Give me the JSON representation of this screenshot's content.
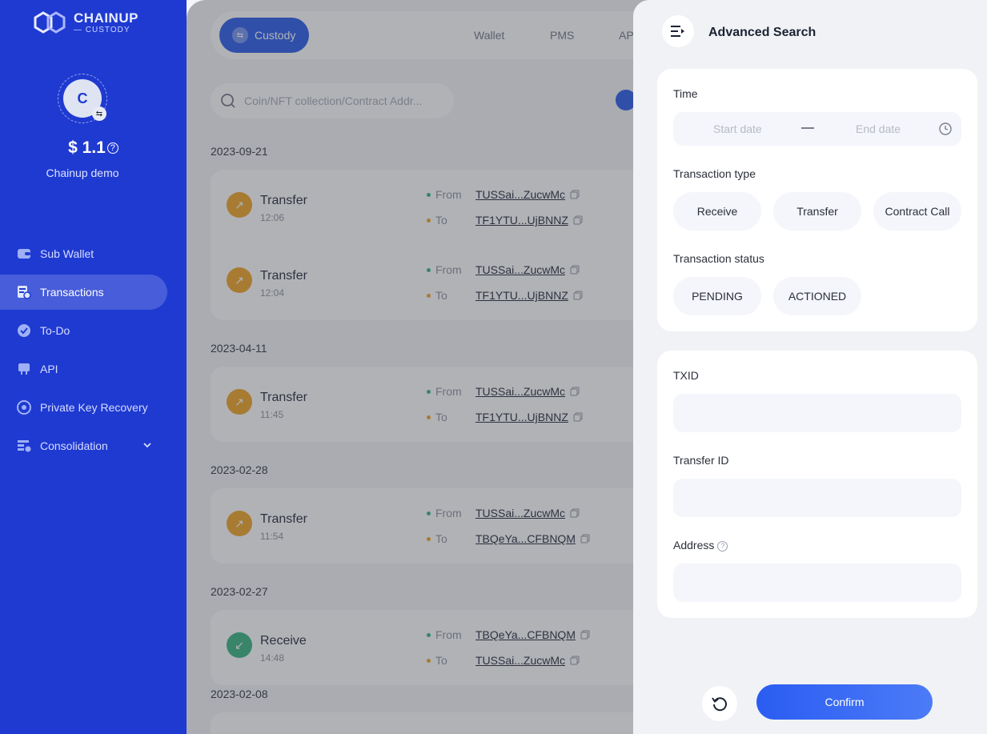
{
  "brand": {
    "name": "CHAINUP",
    "sub": "— CUSTODY"
  },
  "account": {
    "avatar_letter": "C",
    "balance": "$ 1.1",
    "name": "Chainup demo"
  },
  "sidebar": {
    "items": [
      {
        "label": "Sub Wallet",
        "icon": "wallet-icon"
      },
      {
        "label": "Transactions",
        "icon": "transactions-icon",
        "active": true
      },
      {
        "label": "To-Do",
        "icon": "check-circle-icon"
      },
      {
        "label": "API",
        "icon": "api-icon"
      },
      {
        "label": "Private Key Recovery",
        "icon": "key-recovery-icon"
      },
      {
        "label": "Consolidation",
        "icon": "consolidation-icon"
      }
    ]
  },
  "topnav": {
    "active_tab": "Custody",
    "tabs": [
      "Wallet",
      "PMS",
      "AP"
    ]
  },
  "search": {
    "placeholder": "Coin/NFT collection/Contract Addr..."
  },
  "transactions": {
    "groups": [
      {
        "date": "2023-09-21",
        "items": [
          {
            "type": "Transfer",
            "time": "12:06",
            "from": "TUSSai...ZucwMc",
            "to": "TF1YTU...UjBNNZ"
          },
          {
            "type": "Transfer",
            "time": "12:04",
            "from": "TUSSai...ZucwMc",
            "to": "TF1YTU...UjBNNZ"
          }
        ]
      },
      {
        "date": "2023-04-11",
        "items": [
          {
            "type": "Transfer",
            "time": "11:45",
            "from": "TUSSai...ZucwMc",
            "to": "TF1YTU...UjBNNZ"
          }
        ]
      },
      {
        "date": "2023-02-28",
        "items": [
          {
            "type": "Transfer",
            "time": "11:54",
            "from": "TUSSai...ZucwMc",
            "to": "TBQeYa...CFBNQM"
          }
        ]
      },
      {
        "date": "2023-02-27",
        "items": [
          {
            "type": "Receive",
            "time": "14:48",
            "from": "TBQeYa...CFBNQM",
            "to": "TUSSai...ZucwMc"
          }
        ]
      },
      {
        "date": "2023-02-08",
        "items": []
      }
    ],
    "from_label": "From",
    "to_label": "To"
  },
  "advanced_search": {
    "title": "Advanced Search",
    "time_label": "Time",
    "start_placeholder": "Start date",
    "end_placeholder": "End date",
    "type_label": "Transaction type",
    "types": [
      "Receive",
      "Transfer",
      "Contract Call"
    ],
    "status_label": "Transaction status",
    "statuses": [
      "PENDING",
      "ACTIONED"
    ],
    "txid_label": "TXID",
    "transfer_id_label": "Transfer ID",
    "address_label": "Address",
    "confirm_label": "Confirm"
  },
  "colors": {
    "sidebar": "#1f3ad1",
    "primary": "#2255e8",
    "transfer": "#f0a11e",
    "receive": "#2fb17a"
  }
}
